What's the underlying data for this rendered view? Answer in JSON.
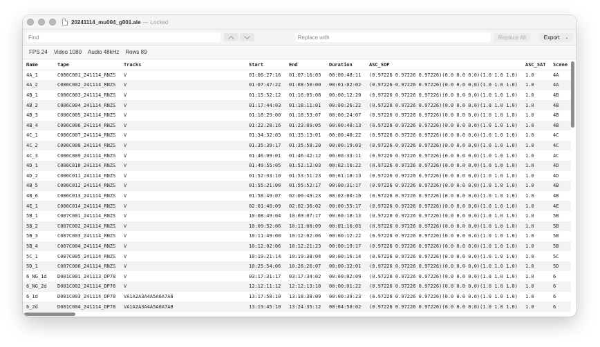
{
  "window": {
    "title": "20241114_mu004_g001.ale",
    "separator": "—",
    "status": "Locked"
  },
  "find": {
    "placeholder": "Find",
    "up_icon": "chevron-up-icon",
    "down_icon": "chevron-down-icon"
  },
  "replace": {
    "placeholder": "Replace with",
    "replace_all_label": "Replace All",
    "export_label": "Export",
    "export_chevron": "⌄"
  },
  "info": {
    "fps": "FPS 24",
    "video": "Video 1080",
    "audio": "Audio 48kHz",
    "rows": "Rows 89"
  },
  "table": {
    "columns": [
      "Name",
      "Tape",
      "Tracks",
      "Start",
      "End",
      "Duration",
      "ASC_SOP",
      "ASC_SAT",
      "Scene"
    ],
    "rows": [
      [
        "4A_1",
        "C006C001_241114_RNZS",
        "V",
        "01:06:27:16",
        "01:07:16:03",
        "00:00:48:11",
        "(0.97226 0.97226 0.97226)(0.0 0.0 0.0)(1.0 1.0 1.0)",
        "1.0",
        "4A"
      ],
      [
        "4A_2",
        "C006C002_241114_RNZS",
        "V",
        "01:07:47:22",
        "01:08:50:00",
        "00:01:02:02",
        "(0.97226 0.97226 0.97226)(0.0 0.0 0.0)(1.0 1.0 1.0)",
        "1.0",
        "4A"
      ],
      [
        "4B_1",
        "C006C003_241114_RNZS",
        "V",
        "01:15:52:12",
        "01:16:05:08",
        "00:00:12:20",
        "(0.97226 0.97226 0.97226)(0.0 0.0 0.0)(1.0 1.0 1.0)",
        "1.0",
        "4B"
      ],
      [
        "4B_2",
        "C006C004_241114_RNZS",
        "V",
        "01:17:44:03",
        "01:18:11:01",
        "00:00:26:22",
        "(0.97226 0.97226 0.97226)(0.0 0.0 0.0)(1.0 1.0 1.0)",
        "1.0",
        "4B"
      ],
      [
        "4B_3",
        "C006C005_241114_RNZS",
        "V",
        "01:18:29:00",
        "01:18:53:07",
        "00:00:24:07",
        "(0.97226 0.97226 0.97226)(0.0 0.0 0.0)(1.0 1.0 1.0)",
        "1.0",
        "4B"
      ],
      [
        "4B_4",
        "C006C006_241114_RNZS",
        "V",
        "01:22:28:16",
        "01:23:09:05",
        "00:00:40:13",
        "(0.97226 0.97226 0.97226)(0.0 0.0 0.0)(1.0 1.0 1.0)",
        "1.0",
        "4B"
      ],
      [
        "4C_1",
        "C006C007_241114_RNZS",
        "V",
        "01:34:32:03",
        "01:35:13:01",
        "00:00:40:22",
        "(0.97226 0.97226 0.97226)(0.0 0.0 0.0)(1.0 1.0 1.0)",
        "1.0",
        "4C"
      ],
      [
        "4C_2",
        "C006C008_241114_RNZS",
        "V",
        "01:35:39:17",
        "01:35:58:20",
        "00:00:19:03",
        "(0.97226 0.97226 0.97226)(0.0 0.0 0.0)(1.0 1.0 1.0)",
        "1.0",
        "4C"
      ],
      [
        "4C_3",
        "C006C009_241114_RNZS",
        "V",
        "01:46:09:01",
        "01:46:42:12",
        "00:00:33:11",
        "(0.97226 0.97226 0.97226)(0.0 0.0 0.0)(1.0 1.0 1.0)",
        "1.0",
        "4C"
      ],
      [
        "4D_1",
        "C006C010_241114_RNZS",
        "V",
        "01:49:55:05",
        "01:52:12:03",
        "00:02:16:22",
        "(0.97226 0.97226 0.97226)(0.0 0.0 0.0)(1.0 1.0 1.0)",
        "1.0",
        "4D"
      ],
      [
        "4D_2",
        "C006C011_241114_RNZS",
        "V",
        "01:52:33:10",
        "01:53:51:23",
        "00:01:18:13",
        "(0.97226 0.97226 0.97226)(0.0 0.0 0.0)(1.0 1.0 1.0)",
        "1.0",
        "4D"
      ],
      [
        "4B_5",
        "C006C012_241114_RNZS",
        "V",
        "01:55:21:00",
        "01:55:52:17",
        "00:00:31:17",
        "(0.97226 0.97226 0.97226)(0.0 0.0 0.0)(1.0 1.0 1.0)",
        "1.0",
        "4B"
      ],
      [
        "4B_6",
        "C006C013_241114_RNZS",
        "V",
        "01:58:49:07",
        "02:00:49:23",
        "00:02:00:16",
        "(0.97226 0.97226 0.97226)(0.0 0.0 0.0)(1.0 1.0 1.0)",
        "1.0",
        "4B"
      ],
      [
        "4E_1",
        "C006C014_241114_RNZS",
        "V",
        "02:01:40:09",
        "02:02:36:02",
        "00:00:55:17",
        "(0.97226 0.97226 0.97226)(0.0 0.0 0.0)(1.0 1.0 1.0)",
        "1.0",
        "4E"
      ],
      [
        "5B_1",
        "C007C001_241114_RNZS",
        "V",
        "10:08:49:04",
        "10:09:07:17",
        "00:00:18:13",
        "(0.97226 0.97226 0.97226)(0.0 0.0 0.0)(1.0 1.0 1.0)",
        "1.0",
        "5B"
      ],
      [
        "5B_2",
        "C007C002_241114_RNZS",
        "V",
        "10:09:52:06",
        "10:11:08:09",
        "00:01:16:03",
        "(0.97226 0.97226 0.97226)(0.0 0.0 0.0)(1.0 1.0 1.0)",
        "1.0",
        "5B"
      ],
      [
        "5B_3",
        "C007C003_241114_RNZS",
        "V",
        "10:11:49:08",
        "10:12:02:06",
        "00:00:12:22",
        "(0.97226 0.97226 0.97226)(0.0 0.0 0.0)(1.0 1.0 1.0)",
        "1.0",
        "5B"
      ],
      [
        "5B_4",
        "C007C004_241114_RNZS",
        "V",
        "10:12:02:06",
        "10:12:21:23",
        "00:00:19:17",
        "(0.97226 0.97226 0.97226)(0.0 0.0 0.0)(1.0 1.0 1.0)",
        "1.0",
        "5B"
      ],
      [
        "5C_1",
        "C007C005_241114_RNZS",
        "V",
        "10:19:21:14",
        "10:19:38:04",
        "00:00:16:14",
        "(0.97226 0.97226 0.97226)(0.0 0.0 0.0)(1.0 1.0 1.0)",
        "1.0",
        "5C"
      ],
      [
        "5D_1",
        "C007C006_241114_RNZS",
        "V",
        "10:25:54:06",
        "10:26:26:07",
        "00:00:32:01",
        "(0.97226 0.97226 0.97226)(0.0 0.0 0.0)(1.0 1.0 1.0)",
        "1.0",
        "5D"
      ],
      [
        "6_NG_1d",
        "D001C001_241113_DP78",
        "V",
        "03:17:31:17",
        "03:17:34:02",
        "00:00:02:09",
        "(0.97226 0.97226 0.97226)(0.0 0.0 0.0)(1.0 1.0 1.0)",
        "1.0",
        "6"
      ],
      [
        "6_NG_2d",
        "D001C002_241114_DP78",
        "V",
        "12:12:11:12",
        "12:12:13:10",
        "00:00:01:22",
        "(0.97226 0.97226 0.97226)(0.0 0.0 0.0)(1.0 1.0 1.0)",
        "1.0",
        "6"
      ],
      [
        "6_1d",
        "D001C003_241114_DP78",
        "VA1A2A3A4A5A6A7A8",
        "13:17:58:10",
        "13:18:38:09",
        "00:00:39:23",
        "(0.97226 0.97226 0.97226)(0.0 0.0 0.0)(1.0 1.0 1.0)",
        "1.0",
        "6"
      ],
      [
        "6_2d",
        "D001C004_241114_DP78",
        "VA1A2A3A4A5A6A7A8",
        "13:19:45:10",
        "13:24:35:12",
        "00:04:50:02",
        "(0.97226 0.97226 0.97226)(0.0 0.0 0.0)(1.0 1.0 1.0)",
        "1.0",
        "6"
      ]
    ]
  }
}
